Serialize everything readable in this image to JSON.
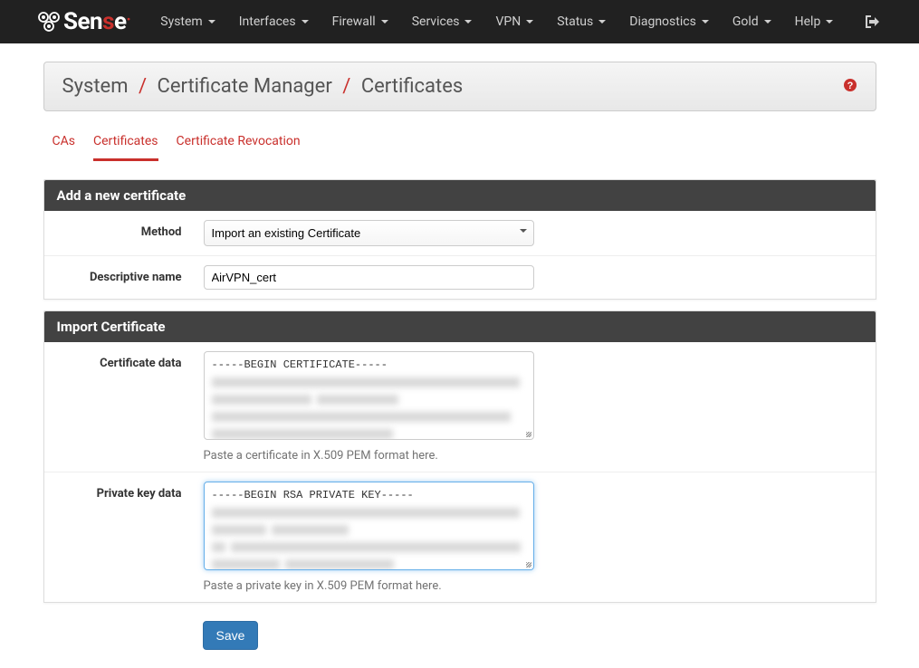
{
  "nav": {
    "items": [
      "System",
      "Interfaces",
      "Firewall",
      "Services",
      "VPN",
      "Status",
      "Diagnostics",
      "Gold",
      "Help"
    ]
  },
  "breadcrumb": {
    "a": "System",
    "b": "Certificate Manager",
    "c": "Certificates"
  },
  "tabs": {
    "items": [
      "CAs",
      "Certificates",
      "Certificate Revocation"
    ],
    "active": 1
  },
  "panel1": {
    "title": "Add a new certificate",
    "method_label": "Method",
    "method_value": "Import an existing Certificate",
    "descname_label": "Descriptive name",
    "descname_value": "AirVPN_cert"
  },
  "panel2": {
    "title": "Import Certificate",
    "certdata_label": "Certificate data",
    "certdata_firstline": "-----BEGIN CERTIFICATE-----",
    "certdata_help": "Paste a certificate in X.509 PEM format here.",
    "pkdata_label": "Private key data",
    "pkdata_firstline": "-----BEGIN RSA PRIVATE KEY-----",
    "pkdata_help": "Paste a private key in X.509 PEM format here."
  },
  "buttons": {
    "save": "Save"
  }
}
